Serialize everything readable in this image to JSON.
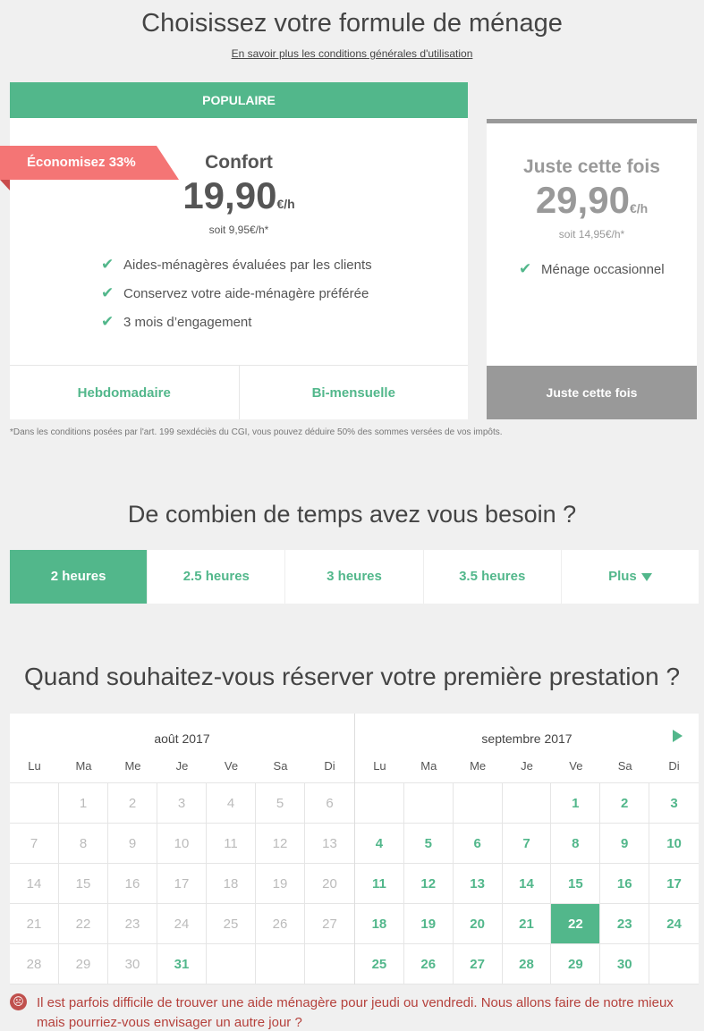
{
  "page": {
    "title": "Choisissez votre formule de ménage",
    "tos_link": "En savoir plus les conditions générales d'utilisation"
  },
  "plans": {
    "popular": {
      "header": "POPULAIRE",
      "badge": "Économisez 33%",
      "name": "Confort",
      "price": "19,90",
      "unit": "€/h",
      "sub": "soit 9,95€/h*",
      "features": [
        "Aides-ménagères évaluées par les clients",
        "Conservez votre aide-ménagère préférée",
        "3 mois d’engagement"
      ],
      "options": [
        "Hebdomadaire",
        "Bi-mensuelle"
      ]
    },
    "once": {
      "name": "Juste cette fois",
      "price": "29,90",
      "unit": "€/h",
      "sub": "soit 14,95€/h*",
      "features": [
        "Ménage occasionnel"
      ],
      "button": "Juste cette fois"
    },
    "note": "*Dans les conditions posées par l'art. 199 sexdéciès du CGI, vous pouvez déduire 50% des sommes versées de vos impôts."
  },
  "duration": {
    "title": "De combien de temps avez vous besoin ?",
    "options": [
      "2 heures",
      "2.5 heures",
      "3 heures",
      "3.5 heures",
      "Plus"
    ],
    "selected": "2 heures"
  },
  "booking": {
    "title": "Quand souhaitez-vous réserver votre première prestation ?",
    "weekdays": [
      "Lu",
      "Ma",
      "Me",
      "Je",
      "Ve",
      "Sa",
      "Di"
    ],
    "months": [
      {
        "title": "août 2017",
        "weeks": [
          [
            "",
            "1",
            "2",
            "3",
            "4",
            "5",
            "6"
          ],
          [
            "7",
            "8",
            "9",
            "10",
            "11",
            "12",
            "13"
          ],
          [
            "14",
            "15",
            "16",
            "17",
            "18",
            "19",
            "20"
          ],
          [
            "21",
            "22",
            "23",
            "24",
            "25",
            "26",
            "27"
          ],
          [
            "28",
            "29",
            "30",
            "31",
            "",
            "",
            ""
          ]
        ],
        "available": [
          "31"
        ],
        "selected": ""
      },
      {
        "title": "septembre 2017",
        "weeks": [
          [
            "",
            "",
            "",
            "",
            "1",
            "2",
            "3"
          ],
          [
            "4",
            "5",
            "6",
            "7",
            "8",
            "9",
            "10"
          ],
          [
            "11",
            "12",
            "13",
            "14",
            "15",
            "16",
            "17"
          ],
          [
            "18",
            "19",
            "20",
            "21",
            "22",
            "23",
            "24"
          ],
          [
            "25",
            "26",
            "27",
            "28",
            "29",
            "30",
            ""
          ]
        ],
        "available": [
          "1",
          "2",
          "3",
          "4",
          "5",
          "6",
          "7",
          "8",
          "9",
          "10",
          "11",
          "12",
          "13",
          "14",
          "15",
          "16",
          "17",
          "18",
          "19",
          "20",
          "21",
          "22",
          "23",
          "24",
          "25",
          "26",
          "27",
          "28",
          "29",
          "30"
        ],
        "selected": "22"
      }
    ],
    "warning": "Il est parfois difficile de trouver une aide ménagère pour jeudi ou vendredi. Nous allons faire de notre mieux mais pourriez-vous envisager un autre jour ?"
  },
  "colors": {
    "accent": "#52b78b",
    "badge": "#f47575",
    "muted": "#999999",
    "warning": "#b5413c"
  },
  "icons": {
    "check": "check-icon",
    "next": "next-month-arrow-icon",
    "dropdown": "caret-down-icon",
    "warning": "sad-face-icon"
  }
}
